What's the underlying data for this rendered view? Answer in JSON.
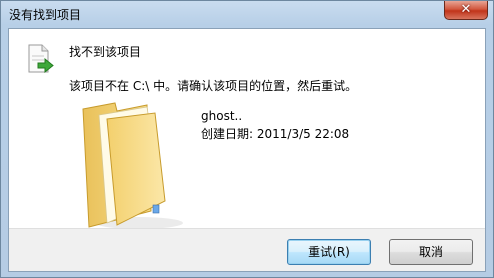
{
  "window": {
    "title": "没有找到项目",
    "close_symbol": "✕"
  },
  "dialog": {
    "heading": "找不到该项目",
    "message": "该项目不在 C:\\ 中。请确认该项目的位置，然后重试。",
    "file_name": "ghost..",
    "created_date": "创建日期: 2011/3/5 22:08",
    "icons": {
      "document": "document-move-icon",
      "folder": "folder-icon"
    }
  },
  "buttons": {
    "retry_label": "重试(R)",
    "cancel_label": "取消"
  },
  "colors": {
    "title_gradient_top": "#c9dcef",
    "folder": "#f5d77c",
    "arrow": "#3ea83a",
    "close_button": "#c1341a"
  }
}
